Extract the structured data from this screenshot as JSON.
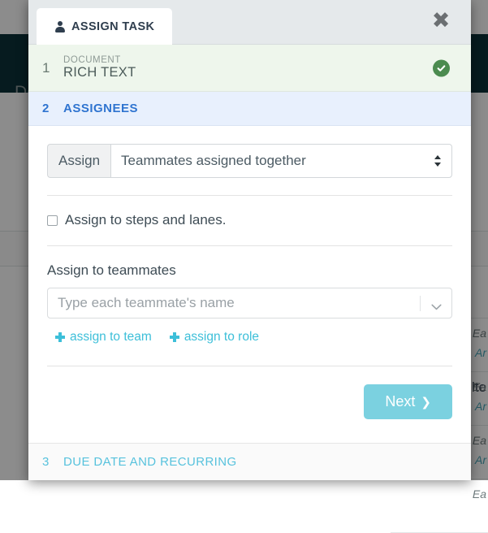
{
  "background": {
    "topbar_title": "Do",
    "filter_label": "ilte",
    "list_rows": [
      {
        "primary": "Ea",
        "secondary": "Ar"
      },
      {
        "primary": "Ea",
        "secondary": "Ar"
      },
      {
        "primary": "Ea",
        "secondary": "Ar"
      },
      {
        "primary": "Ea",
        "secondary": ""
      }
    ]
  },
  "modal": {
    "tab": {
      "label": "ASSIGN TASK",
      "icon": "person-icon"
    },
    "close_icon": "✖",
    "steps": [
      {
        "number": "1",
        "subtitle": "DOCUMENT",
        "title": "RICH TEXT",
        "state": "complete",
        "check_icon": "check-circle-icon"
      },
      {
        "number": "2",
        "title": "ASSIGNEES",
        "state": "active"
      },
      {
        "number": "3",
        "title": "DUE DATE AND RECURRING",
        "state": "pending"
      }
    ],
    "panel": {
      "assign_group": {
        "addon_label": "Assign",
        "selected_value": "Teammates assigned together",
        "options": [
          "Teammates assigned together"
        ],
        "indicator_icon": "up-down-chevron-icon"
      },
      "steps_lanes_checkbox": {
        "label": "Assign to steps and lanes.",
        "checked": false
      },
      "teammates_field": {
        "label": "Assign to teammates",
        "placeholder": "Type each teammate's name",
        "value": "",
        "caret_icon": "chevron-down-icon"
      },
      "links": [
        {
          "label": "assign to team",
          "icon": "plus-icon"
        },
        {
          "label": "assign to role",
          "icon": "plus-icon"
        }
      ],
      "next_button": {
        "label": "Next",
        "chevron": "❯"
      }
    }
  },
  "colors": {
    "topbar": "#0c3239",
    "step_complete_bg": "#eef6ec",
    "step_active_bg": "#e8f0fd",
    "step_active_text": "#2f74d0",
    "step_pending_text": "#57c2dd",
    "accent_cyan": "#3dbfd9",
    "next_button_bg": "#7bd1e0",
    "check_green": "#4b8b4f"
  }
}
